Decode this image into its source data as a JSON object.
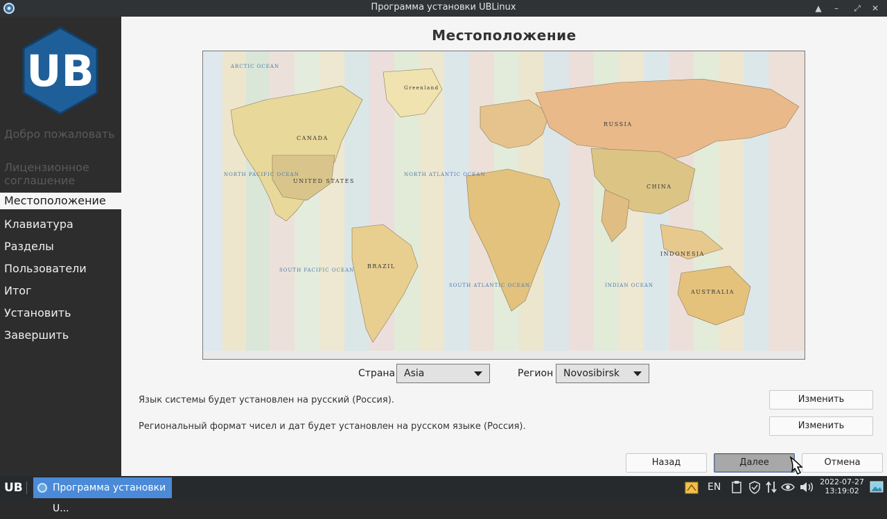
{
  "window": {
    "title": "Программа установки UBLinux",
    "controls": [
      "▲",
      "–",
      "⤢",
      "✕"
    ]
  },
  "sidebar": {
    "logo_text": "UB",
    "items": [
      {
        "label": "Добро пожаловать",
        "state": "done"
      },
      {
        "label": "Лицензионное соглашение",
        "state": "done"
      },
      {
        "label": "Местоположение",
        "state": "active"
      },
      {
        "label": "Клавиатура",
        "state": "pending"
      },
      {
        "label": "Разделы",
        "state": "pending"
      },
      {
        "label": "Пользователи",
        "state": "pending"
      },
      {
        "label": "Итог",
        "state": "pending"
      },
      {
        "label": "Установить",
        "state": "pending"
      },
      {
        "label": "Завершить",
        "state": "pending"
      }
    ]
  },
  "main": {
    "title": "Местоположение",
    "map": {
      "oceans": [
        "ARCTIC OCEAN",
        "NORTH PACIFIC OCEAN",
        "NORTH ATLANTIC OCEAN",
        "SOUTH PACIFIC OCEAN",
        "SOUTH ATLANTIC OCEAN",
        "INDIAN OCEAN"
      ],
      "countries": [
        "CANADA",
        "UNITED STATES",
        "RUSSIA",
        "CHINA",
        "BRAZIL",
        "AUSTRALIA",
        "INDONESIA",
        "Greenland"
      ]
    },
    "country_label": "Страна",
    "country_value": "Asia",
    "region_label": "Регион",
    "region_value": "Novosibirsk",
    "language_info": "Язык системы будет установлен на русский (Россия).",
    "format_info": "Региональный формат чисел и дат будет установлен на русском языке (Россия).",
    "change_label": "Изменить",
    "back_label": "Назад",
    "next_label": "Далее",
    "cancel_label": "Отмена"
  },
  "taskbar": {
    "logo": "UB",
    "task_label": "Программа установки U...",
    "lang": "EN",
    "date": "2022-07-27",
    "time": "13:19:02"
  },
  "colors": {
    "sidebar_bg": "#2d2d2d",
    "main_bg": "#f5f5f5",
    "accent": "#4a8ad8",
    "logo_hex": "#1f5f99"
  }
}
